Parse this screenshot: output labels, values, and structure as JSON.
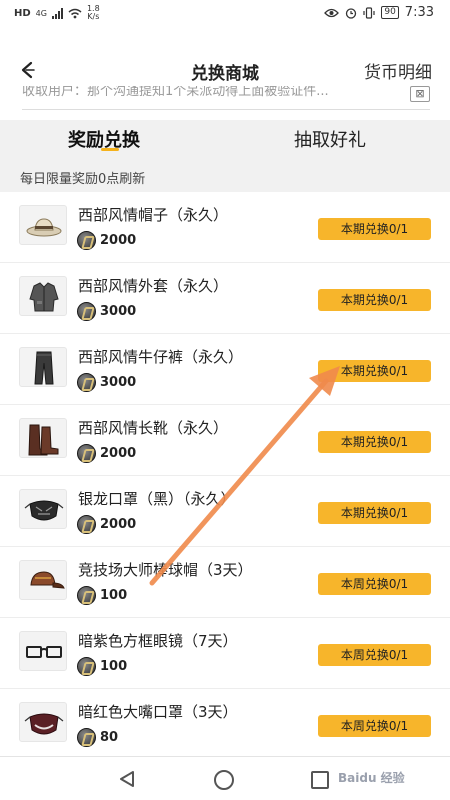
{
  "status_bar": {
    "carrier": "HD",
    "network": "4G",
    "speed_value": "1.8",
    "speed_unit": "K/s",
    "battery": "90",
    "time": "7:33"
  },
  "header": {
    "title": "兑换商城",
    "right_link": "货币明细",
    "ticker_text": "收取用户：那个沟通提知1个呆派动得上面被验证件..."
  },
  "tabs": [
    {
      "label": "奖励兑换",
      "active": true
    },
    {
      "label": "抽取好礼",
      "active": false
    }
  ],
  "refresh_note": "每日限量奖励0点刷新",
  "items": [
    {
      "name": "西部风情帽子（永久）",
      "price": "2000",
      "button": "本期兑换0/1",
      "icon": "cowboy-hat-icon"
    },
    {
      "name": "西部风情外套（永久）",
      "price": "3000",
      "button": "本期兑换0/1",
      "icon": "jacket-icon"
    },
    {
      "name": "西部风情牛仔裤（永久）",
      "price": "3000",
      "button": "本期兑换0/1",
      "icon": "jeans-icon"
    },
    {
      "name": "西部风情长靴（永久）",
      "price": "2000",
      "button": "本期兑换0/1",
      "icon": "boots-icon"
    },
    {
      "name": "银龙口罩（黑）（永久）",
      "price": "2000",
      "button": "本期兑换0/1",
      "icon": "face-mask-icon"
    },
    {
      "name": "竞技场大师棒球帽（3天）",
      "price": "100",
      "button": "本周兑换0/1",
      "icon": "baseball-cap-icon"
    },
    {
      "name": "暗紫色方框眼镜（7天）",
      "price": "100",
      "button": "本周兑换0/1",
      "icon": "glasses-icon"
    },
    {
      "name": "暗红色大嘴口罩（3天）",
      "price": "80",
      "button": "本周兑换0/1",
      "icon": "red-mask-icon"
    }
  ],
  "watermark": "Baidu 经验",
  "colors": {
    "accent": "#f7b52b",
    "annotation_arrow": "#f08a4b"
  }
}
